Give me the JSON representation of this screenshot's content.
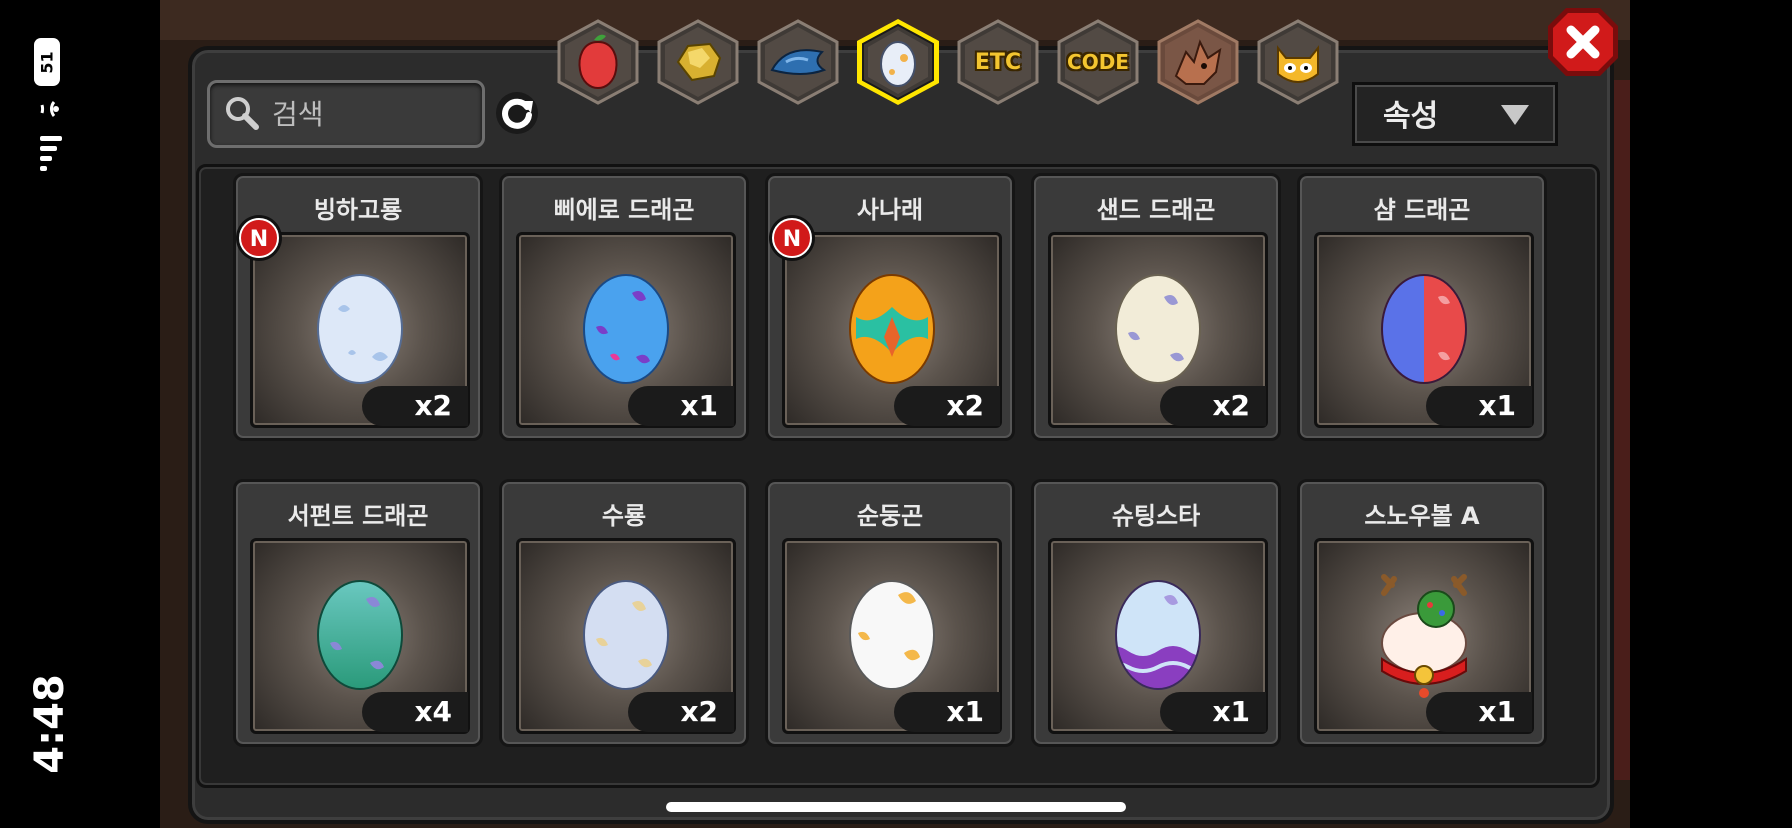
{
  "status_bar": {
    "time": "4:48",
    "battery": "51"
  },
  "search": {
    "placeholder": "검색"
  },
  "tabs": [
    {
      "icon": "fruit-icon",
      "label": ""
    },
    {
      "icon": "gold-ore-icon",
      "label": ""
    },
    {
      "icon": "dragon-scale-icon",
      "label": ""
    },
    {
      "icon": "egg-icon",
      "label": "",
      "selected": true
    },
    {
      "icon": "etc-icon",
      "label": "ETC"
    },
    {
      "icon": "code-icon",
      "label": "CODE"
    },
    {
      "icon": "dragon-head-icon",
      "label": ""
    },
    {
      "icon": "monster-icon",
      "label": ""
    }
  ],
  "sort_dropdown": {
    "label": "속성"
  },
  "items": [
    {
      "name": "빙하고룡",
      "count": "x2",
      "is_new": true,
      "egg": "ice"
    },
    {
      "name": "삐에로 드래곤",
      "count": "x1",
      "is_new": false,
      "egg": "pierrot"
    },
    {
      "name": "사나래",
      "count": "x2",
      "is_new": true,
      "egg": "sanarae"
    },
    {
      "name": "샌드 드래곤",
      "count": "x2",
      "is_new": false,
      "egg": "sand"
    },
    {
      "name": "샴 드래곤",
      "count": "x1",
      "is_new": false,
      "egg": "siam"
    },
    {
      "name": "서펀트 드래곤",
      "count": "x4",
      "is_new": false,
      "egg": "serpent"
    },
    {
      "name": "수룡",
      "count": "x2",
      "is_new": false,
      "egg": "water"
    },
    {
      "name": "순둥곤",
      "count": "x1",
      "is_new": false,
      "egg": "gentle"
    },
    {
      "name": "슈팅스타",
      "count": "x1",
      "is_new": false,
      "egg": "shootingstar"
    },
    {
      "name": "스노우볼 A",
      "count": "x1",
      "is_new": false,
      "egg": "snowball"
    }
  ],
  "new_badge_text": "N",
  "colors": {
    "tab_text": "#f3c530",
    "selected_tab_border": "#ffe600",
    "close_button": "#d11a1a",
    "new_badge": "#d11a1a"
  }
}
